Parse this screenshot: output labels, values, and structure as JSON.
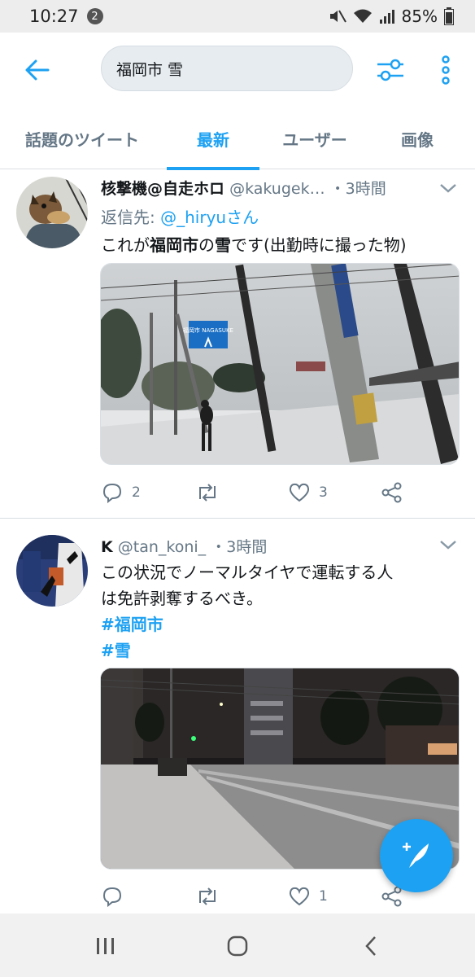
{
  "status_bar": {
    "time": "10:27",
    "notification_count": "2",
    "battery": "85%"
  },
  "search": {
    "query": "福岡市 雪"
  },
  "tabs": [
    {
      "label": "話題のツイート",
      "active": false
    },
    {
      "label": "最新",
      "active": true
    },
    {
      "label": "ユーザー",
      "active": false
    },
    {
      "label": "画像",
      "active": false
    }
  ],
  "tweets": [
    {
      "name": "核撃機@自走ホロ",
      "handle": "@kakugek…",
      "time": "・3時間",
      "reply_prefix": "返信先:",
      "reply_to": "@_hiryuさん",
      "text_parts": [
        "これが",
        "福岡市",
        "の",
        "雪",
        "です(出勤時に撮った物)"
      ],
      "replies": "2",
      "retweets": "",
      "likes": "3"
    },
    {
      "name": "K",
      "handle": "@tan_koni_",
      "time": "・3時間",
      "text_lines": [
        "この状況でノーマルタイヤで運転する人",
        "は免許剥奪するべき。"
      ],
      "hashtags": [
        "#福岡市",
        "#雪"
      ],
      "replies": "",
      "retweets": "",
      "likes": "1"
    }
  ],
  "photo1_sign": "福岡市 NAGASUKE"
}
